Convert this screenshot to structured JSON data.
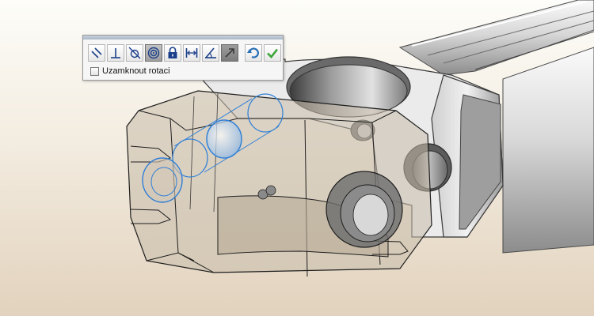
{
  "toolbar": {
    "buttons": [
      {
        "id": "parallel",
        "icon": "parallel-icon",
        "state": "normal"
      },
      {
        "id": "perpendicular",
        "icon": "perpendicular-icon",
        "state": "normal"
      },
      {
        "id": "tangent",
        "icon": "tangent-icon",
        "state": "normal"
      },
      {
        "id": "concentric",
        "icon": "concentric-icon",
        "state": "selected"
      },
      {
        "id": "lock",
        "icon": "lock-icon",
        "state": "normal"
      },
      {
        "id": "distance",
        "icon": "distance-icon",
        "state": "normal"
      },
      {
        "id": "angle",
        "icon": "angle-icon",
        "state": "normal"
      },
      {
        "id": "flip-alignment",
        "icon": "flip-alignment-icon",
        "state": "disabled"
      },
      {
        "id": "undo",
        "icon": "undo-icon",
        "state": "normal"
      },
      {
        "id": "confirm",
        "icon": "checkmark-icon",
        "state": "normal"
      }
    ],
    "lock_rotation_label": "Uzamknout rotaci",
    "lock_rotation_checked": false
  },
  "colors": {
    "selection_blue": "#2f7fd6",
    "accept_green": "#3aa53a",
    "undo_blue": "#2a6fb5"
  }
}
